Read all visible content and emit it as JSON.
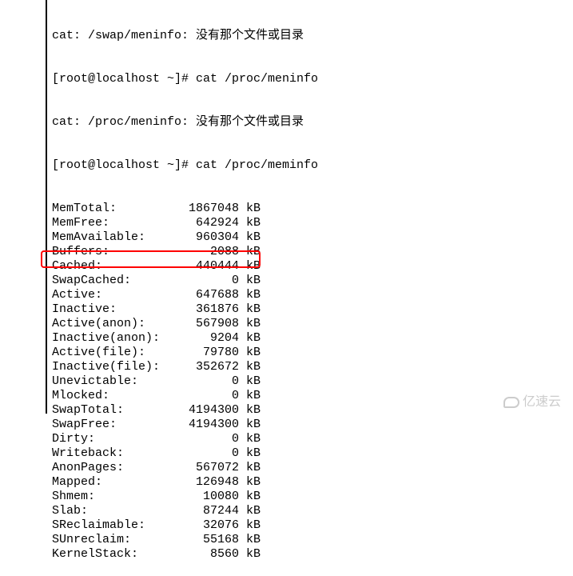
{
  "header_lines": [
    "cat: /swap/meninfo: 没有那个文件或目录",
    "[root@localhost ~]# cat /proc/meninfo",
    "cat: /proc/meninfo: 没有那个文件或目录",
    "[root@localhost ~]# cat /proc/meminfo"
  ],
  "meminfo": [
    {
      "label": "MemTotal:",
      "value": "1867048",
      "unit": "kB"
    },
    {
      "label": "MemFree:",
      "value": "642924",
      "unit": "kB"
    },
    {
      "label": "MemAvailable:",
      "value": "960304",
      "unit": "kB"
    },
    {
      "label": "Buffers:",
      "value": "2088",
      "unit": "kB"
    },
    {
      "label": "Cached:",
      "value": "440444",
      "unit": "kB"
    },
    {
      "label": "SwapCached:",
      "value": "0",
      "unit": "kB"
    },
    {
      "label": "Active:",
      "value": "647688",
      "unit": "kB"
    },
    {
      "label": "Inactive:",
      "value": "361876",
      "unit": "kB"
    },
    {
      "label": "Active(anon):",
      "value": "567908",
      "unit": "kB"
    },
    {
      "label": "Inactive(anon):",
      "value": "9204",
      "unit": "kB"
    },
    {
      "label": "Active(file):",
      "value": "79780",
      "unit": "kB"
    },
    {
      "label": "Inactive(file):",
      "value": "352672",
      "unit": "kB"
    },
    {
      "label": "Unevictable:",
      "value": "0",
      "unit": "kB"
    },
    {
      "label": "Mlocked:",
      "value": "0",
      "unit": "kB"
    },
    {
      "label": "SwapTotal:",
      "value": "4194300",
      "unit": "kB"
    },
    {
      "label": "SwapFree:",
      "value": "4194300",
      "unit": "kB"
    },
    {
      "label": "Dirty:",
      "value": "0",
      "unit": "kB"
    },
    {
      "label": "Writeback:",
      "value": "0",
      "unit": "kB"
    },
    {
      "label": "AnonPages:",
      "value": "567072",
      "unit": "kB"
    },
    {
      "label": "Mapped:",
      "value": "126948",
      "unit": "kB"
    },
    {
      "label": "Shmem:",
      "value": "10080",
      "unit": "kB"
    },
    {
      "label": "Slab:",
      "value": "87244",
      "unit": "kB"
    },
    {
      "label": "SReclaimable:",
      "value": "32076",
      "unit": "kB"
    },
    {
      "label": "SUnreclaim:",
      "value": "55168",
      "unit": "kB"
    },
    {
      "label": "KernelStack:",
      "value": "8560",
      "unit": "kB"
    }
  ],
  "watermark_text": "亿速云",
  "highlighted_row_index": 14,
  "colors": {
    "highlight_border": "#ff0000",
    "text": "#000000",
    "background": "#ffffff"
  }
}
